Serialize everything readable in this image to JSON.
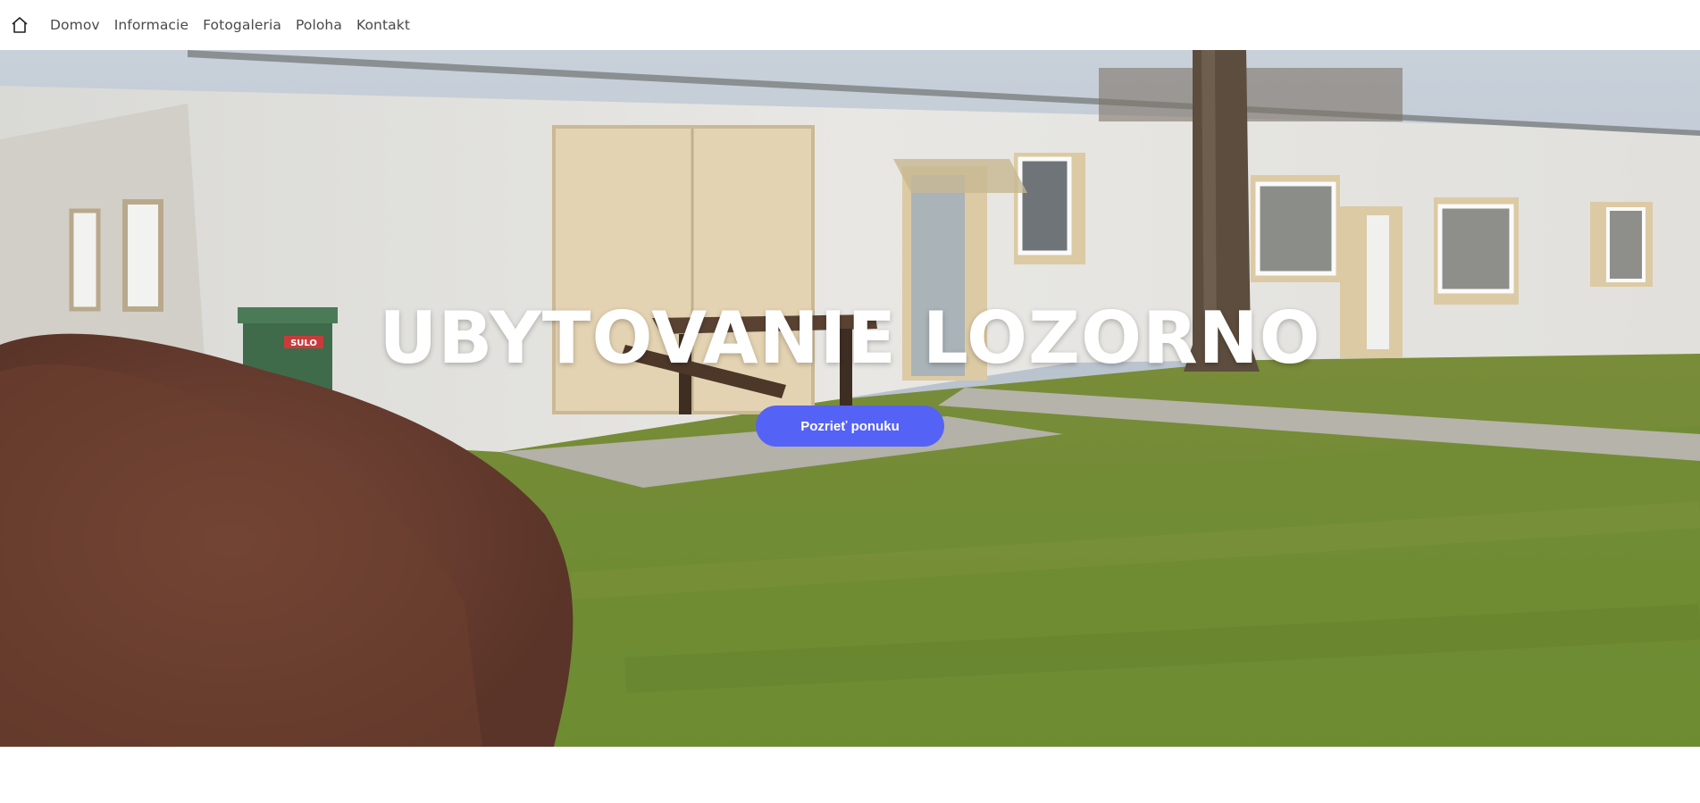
{
  "nav": {
    "home_icon": "home-icon",
    "items": [
      {
        "label": "Domov"
      },
      {
        "label": "Informacie"
      },
      {
        "label": "Fotogaleria"
      },
      {
        "label": "Poloha"
      },
      {
        "label": "Kontakt"
      }
    ]
  },
  "hero": {
    "title": "UBYTOVANIE LOZORNO",
    "cta_label": "Pozrieť ponuku",
    "bin_label": "SULO"
  },
  "colors": {
    "accent": "#5562f6",
    "title": "#ffffff"
  }
}
